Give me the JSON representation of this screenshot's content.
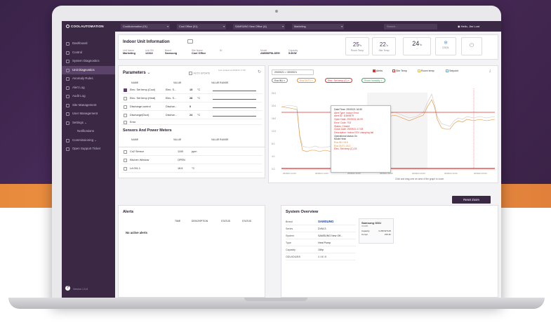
{
  "topbar": {
    "org": "CoolAutomation (01)",
    "site": "Cool Office (01)",
    "system": "SAMSUNG New Office (A)",
    "unit": "Marketing",
    "search_placeholder": "Search...",
    "user": "Hello, Jim Lord"
  },
  "sidebar": {
    "logo": "COOLAUTOMATION",
    "items": [
      {
        "label": "Dashboard"
      },
      {
        "label": "Control"
      },
      {
        "label": "System Diagnostics"
      },
      {
        "label": "Unit Diagnostics"
      },
      {
        "label": "Anomaly Rules"
      },
      {
        "label": "Alert Log"
      },
      {
        "label": "Audit Log"
      },
      {
        "label": "Site Management"
      },
      {
        "label": "User Management"
      },
      {
        "label": "Settings"
      },
      {
        "label": "Notifications"
      },
      {
        "label": "Commissioning"
      },
      {
        "label": "Open Support Ticket"
      }
    ],
    "version": "Version 1.0.8"
  },
  "indoor": {
    "title": "Indoor Unit Information",
    "fields": [
      {
        "label": "Unit Name",
        "value": "Marketing"
      },
      {
        "label": "Unit SN",
        "value": "12344"
      },
      {
        "label": "Brand",
        "value": "Samsung"
      },
      {
        "label": "Site Name",
        "value": "Cool Office"
      },
      {
        "label": "ID",
        "value": ""
      },
      {
        "label": "Model",
        "value": "AM056FNLDEH"
      },
      {
        "label": "Capacity",
        "value": "5.6KW"
      }
    ],
    "room_temp": "25",
    "room_temp_label": "Room Temp",
    "site_temp": "22",
    "site_temp_label": "Site Temp",
    "setpoint": "24",
    "unit": "°c",
    "mode": "COOL"
  },
  "parameters": {
    "title": "Parameters",
    "auto_update": "AUTO UPDATE",
    "last_updated": "Last updated at 29/09/21 17:08",
    "headers": [
      "NAME",
      "VALUE",
      "VALUE RANGE"
    ],
    "rows": [
      {
        "name": "Elec. Set temp.(Cool)",
        "src": "Elec. S...",
        "value": "15",
        "unit": "°C",
        "checked": true
      },
      {
        "name": "Elec. Set temp.(Heat)",
        "src": "Elec. S...",
        "value": "28",
        "unit": "°C",
        "checked": false
      },
      {
        "name": "Discharge control",
        "src": "Dischar...",
        "value": "0",
        "unit": "",
        "checked": false
      },
      {
        "name": "Discharge(Duct)",
        "src": "Dischar...",
        "value": "24",
        "unit": "°C",
        "checked": false
      },
      {
        "name": "Error",
        "src": "",
        "value": "",
        "unit": "",
        "checked": false
      }
    ]
  },
  "sensors": {
    "title": "Sensors And Power Meters",
    "headers": [
      "NAME",
      "VALUE",
      "VALUE RANGE"
    ],
    "rows": [
      {
        "name": "Co2 Sensor",
        "value": "1100",
        "unit": "ppm"
      },
      {
        "name": "Kitchen Window",
        "value": "OPEN",
        "unit": ""
      },
      {
        "name": "LA 001.1",
        "value": "18.8",
        "unit": "°C"
      }
    ]
  },
  "chart": {
    "range": "29/09/21 > 30/09/21",
    "toggles": [
      {
        "label": "Alerts",
        "checked": true
      },
      {
        "label": "Site Temp",
        "checked": true
      },
      {
        "label": "Room temp",
        "checked": false
      },
      {
        "label": "Setpoint",
        "checked": false
      }
    ],
    "chips": [
      "Eva IN1",
      "Eva OUT1",
      "Elec. Set temp.(C)",
      "Room humidity"
    ],
    "yticks": [
      "24.0",
      "20.0",
      "16.0",
      "12.0",
      "8.0",
      "4.0",
      "0.0"
    ],
    "xticks": [
      "29/09/21 12:00",
      "29/09/21 14:00",
      "29/09/21 16:00",
      "29/09/21 18:00",
      "29/09/21 20:00",
      "29/09/21 22:00",
      "30/09/21 00:00"
    ],
    "hint": "Click and drag over an area of the graph to zoom",
    "reset": "Reset Zoom",
    "tooltip": [
      {
        "t": "Date/Time: 29/09/21 16:50",
        "c": ""
      },
      {
        "t": "Alert Type: Indoor Error",
        "c": "tt-red"
      },
      {
        "t": "Alert ID: 11849879",
        "c": "tt-red"
      },
      {
        "t": "Open Date: 29/09/21 16:09",
        "c": "tt-red"
      },
      {
        "t": "Error Code: 703",
        "c": "tt-red"
      },
      {
        "t": "Status: Closed",
        "c": "tt-red"
      },
      {
        "t": "Close Date: 29/09/21 17:05",
        "c": "tt-red"
      },
      {
        "t": "Description: Indoor EEV clamping fail",
        "c": "tt-red"
      },
      {
        "t": "Operational status      On",
        "c": ""
      },
      {
        "t": "Mode                    Heat",
        "c": ""
      },
      {
        "t": "Eva IN1                 18.5",
        "c": "tt-orange"
      },
      {
        "t": "Eva OUT1                18.2",
        "c": "tt-orange"
      },
      {
        "t": "Elec. Set temp.(C)      15",
        "c": "tt-red"
      }
    ]
  },
  "alerts": {
    "title": "Alerts",
    "headers": [
      "TIME",
      "DESCRIPTION",
      "STATUS",
      "STATUS"
    ],
    "empty": "No active alerts"
  },
  "system": {
    "title": "System Overview",
    "rows": [
      {
        "label": "Brand",
        "value": "SAMSUNG"
      },
      {
        "label": "Series",
        "value": "DVM-S"
      },
      {
        "label": "System",
        "value": "SAMSUNG New Off..."
      },
      {
        "label": "Type",
        "value": "Heat Pump"
      },
      {
        "label": "Capacity",
        "value": "15hp"
      },
      {
        "label": "ODU/IDU/BS",
        "value": "1 / 6 / 0"
      }
    ],
    "odu_title": "Samsung ODU",
    "odu_sub": "model",
    "odu_rows": [
      {
        "label": "Capacity",
        "value": "0.25KWT125"
      },
      {
        "label": "Compr",
        "value": "155.3h"
      }
    ]
  }
}
